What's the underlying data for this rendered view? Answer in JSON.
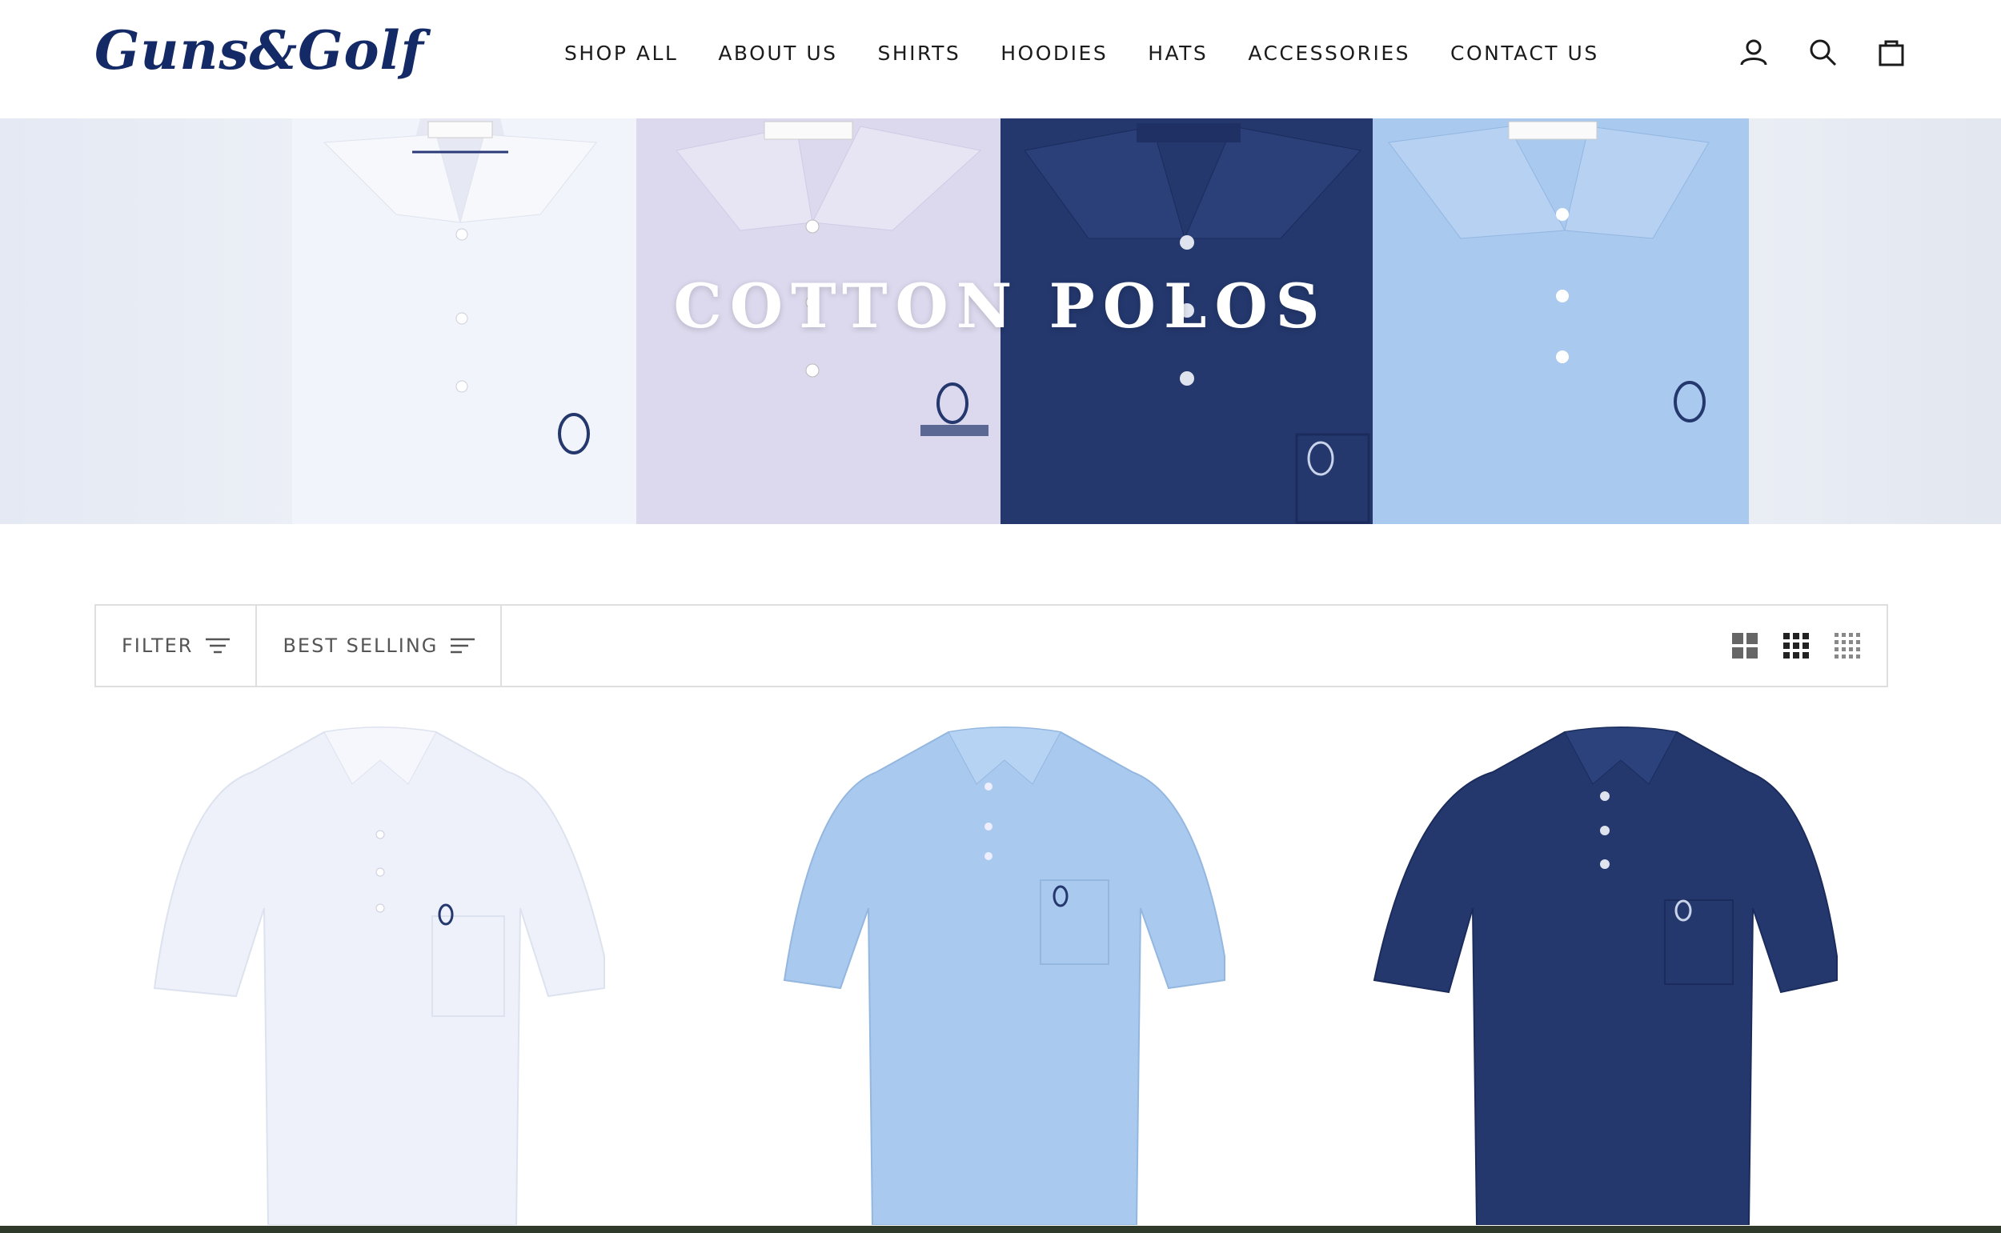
{
  "header": {
    "logo": "Guns&Golf",
    "nav": [
      "SHOP ALL",
      "ABOUT US",
      "SHIRTS",
      "HOODIES",
      "HATS",
      "ACCESSORIES",
      "CONTACT US"
    ],
    "icons": [
      "account-icon",
      "search-icon",
      "cart-icon"
    ]
  },
  "hero": {
    "title": "COTTON POLOS"
  },
  "toolbar": {
    "filter_label": "FILTER",
    "sort_label": "BEST SELLING",
    "grid_options": [
      "grid-2-icon",
      "grid-3-icon",
      "grid-4-icon"
    ]
  },
  "colors": {
    "brand_navy": "#142a66",
    "polo_white": "#eef1fa",
    "polo_lilac": "#dcd9ee",
    "polo_navy": "#24386e",
    "polo_light_blue": "#a9c9ee"
  }
}
